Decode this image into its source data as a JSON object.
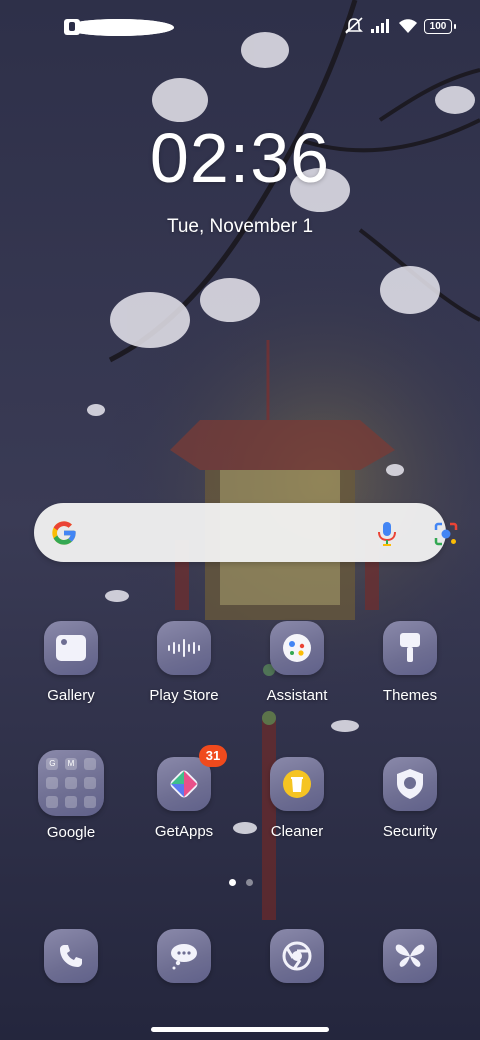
{
  "status_bar": {
    "left_icons": [
      "notification-app-icon",
      "notification-square-icon",
      "notification-app-icon"
    ],
    "right_icons": [
      "mute-icon",
      "signal-icon",
      "wifi-icon",
      "battery-icon"
    ],
    "battery_level": "100"
  },
  "lockscreen": {
    "time": "02:36",
    "date": "Tue, November 1"
  },
  "search": {
    "icons": [
      "google-logo",
      "mic-icon",
      "lens-icon"
    ],
    "colors": {
      "blue": "#4285F4",
      "red": "#EA4335",
      "yellow": "#FBBC05",
      "green": "#34A853"
    }
  },
  "apps": {
    "row1": [
      {
        "label": "Gallery",
        "icon": "gallery-icon"
      },
      {
        "label": "Play Store",
        "icon": "play-store-icon"
      },
      {
        "label": "Assistant",
        "icon": "assistant-icon"
      },
      {
        "label": "Themes",
        "icon": "themes-icon"
      }
    ],
    "row2": [
      {
        "label": "Google",
        "icon": "google-folder-icon"
      },
      {
        "label": "GetApps",
        "icon": "getapps-icon",
        "badge": "31"
      },
      {
        "label": "Cleaner",
        "icon": "cleaner-icon"
      },
      {
        "label": "Security",
        "icon": "security-icon"
      }
    ],
    "folder_letters": [
      "G",
      "M"
    ]
  },
  "dock": [
    {
      "icon": "phone-icon"
    },
    {
      "icon": "messages-icon"
    },
    {
      "icon": "chrome-icon"
    },
    {
      "icon": "butterfly-icon"
    }
  ],
  "page_indicator": {
    "current": 1,
    "total": 2
  },
  "theme": {
    "badge_color": "#f04a1d",
    "background": "#2b2d47"
  }
}
